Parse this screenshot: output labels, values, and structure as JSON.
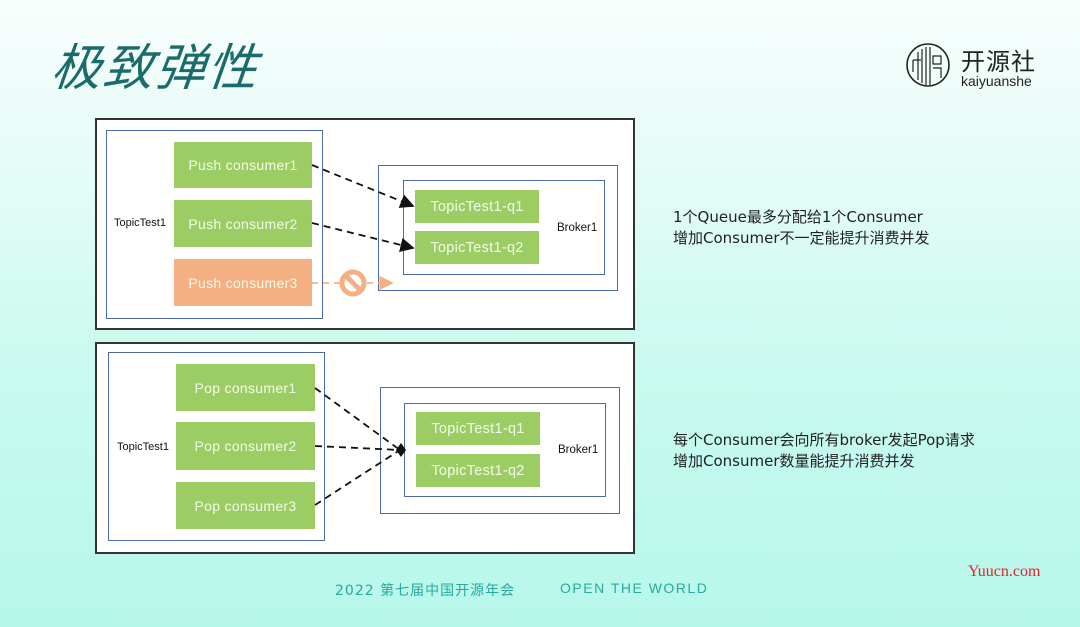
{
  "slide": {
    "title": "极致弹性",
    "logo": {
      "cn": "开源社",
      "en": "kaiyuanshe"
    }
  },
  "diagram_top": {
    "topic_label": "TopicTest1",
    "consumers": [
      {
        "label": "Push consumer1",
        "status": "active",
        "target": "q1"
      },
      {
        "label": "Push consumer2",
        "status": "active",
        "target": "q2"
      },
      {
        "label": "Push consumer3",
        "status": "blocked",
        "target": null
      }
    ],
    "broker_label": "Broker1",
    "queues": [
      "TopicTest1-q1",
      "TopicTest1-q2"
    ],
    "note_lines": [
      "1个Queue最多分配给1个Consumer",
      "增加Consumer不一定能提升消费并发"
    ]
  },
  "diagram_bottom": {
    "topic_label": "TopicTest1",
    "consumers": [
      {
        "label": "Pop consumer1",
        "status": "active"
      },
      {
        "label": "Pop consumer2",
        "status": "active"
      },
      {
        "label": "Pop consumer3",
        "status": "active"
      }
    ],
    "broker_label": "Broker1",
    "queues": [
      "TopicTest1-q1",
      "TopicTest1-q2"
    ],
    "note_lines": [
      "每个Consumer会向所有broker发起Pop请求",
      "增加Consumer数量能提升消费并发"
    ]
  },
  "colors": {
    "active_box": "#9ccd64",
    "blocked_box": "#f4b083",
    "frame": "#4a6aa8",
    "title": "#1c6b6b",
    "footer": "#2aa8a0"
  },
  "footer": {
    "event": "2022 第七届中国开源年会",
    "slogan": "OPEN THE WORLD"
  },
  "watermark": "Yuucn.com"
}
